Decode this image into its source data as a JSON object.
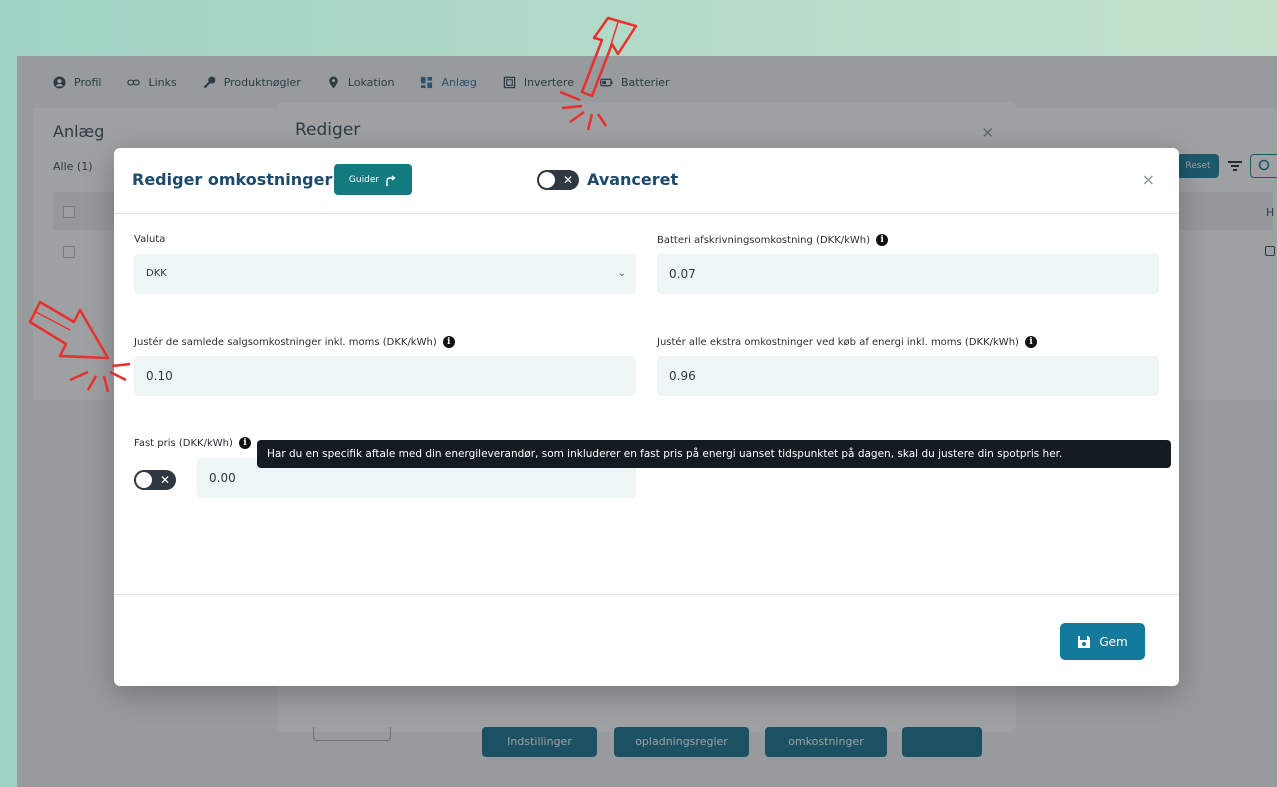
{
  "background_app": {
    "nav": [
      {
        "label": "Profil",
        "icon": "user-circle-icon"
      },
      {
        "label": "Links",
        "icon": "link-icon"
      },
      {
        "label": "Produktnøgler",
        "icon": "key-icon"
      },
      {
        "label": "Lokation",
        "icon": "location-pin-icon"
      },
      {
        "label": "Anlæg",
        "icon": "dashboard-icon"
      },
      {
        "label": "Invertere",
        "icon": "inverter-icon"
      },
      {
        "label": "Batterier",
        "icon": "battery-icon"
      }
    ],
    "page_title": "Anlæg",
    "filter_all": "Alle (1)",
    "reset_label": "Reset",
    "column_h": "H",
    "edit_modal": {
      "title": "Rediger",
      "buttons": [
        "Indstillinger",
        "opladningsregler",
        "omkostninger",
        ""
      ]
    }
  },
  "modal": {
    "title": "Rediger omkostninger",
    "guider_label": "Guider",
    "advanced_label": "Avanceret",
    "close": "×",
    "fields": {
      "currency": {
        "label": "Valuta",
        "value": "DKK"
      },
      "battery_cost": {
        "label": "Batteri afskrivningsomkostning (DKK/kWh)",
        "value": "0.07"
      },
      "sales_cost": {
        "label": "Justér de samlede salgsomkostninger inkl. moms (DKK/kWh)",
        "value": "0.10"
      },
      "purchase_cost": {
        "label": "Justér alle ekstra omkostninger ved køb af energi inkl. moms (DKK/kWh)",
        "value": "0.96"
      },
      "fixed_price": {
        "label": "Fast pris (DKK/kWh)",
        "value": "0.00"
      }
    },
    "tooltip": "Har du en specifik aftale med din energileverandør, som inkluderer en fast pris på energi uanset tidspunktet på dagen, skal du justere din spotpris her.",
    "save_label": "Gem"
  },
  "colors": {
    "primary": "#137a9b",
    "guider": "#137a7f",
    "title": "#1c4a6b",
    "arrow": "#e8312f"
  }
}
